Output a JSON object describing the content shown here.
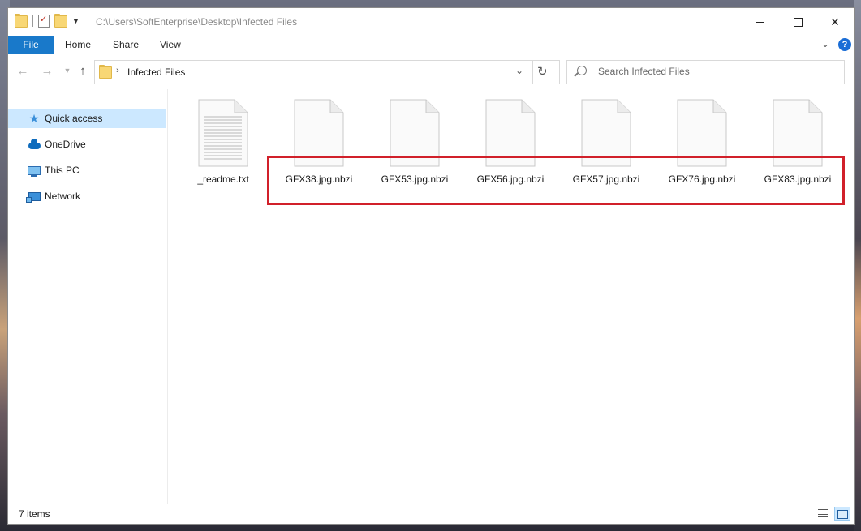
{
  "window": {
    "title_path": "C:\\Users\\SoftEnterprise\\Desktop\\Infected Files",
    "minimize": "minimize",
    "maximize": "maximize",
    "close": "close"
  },
  "ribbon": {
    "tabs": [
      "File",
      "Home",
      "Share",
      "View"
    ],
    "help": "?"
  },
  "address": {
    "crumb": "Infected Files"
  },
  "search": {
    "placeholder": "Search Infected Files"
  },
  "nav_pane": {
    "items": [
      {
        "label": "Quick access",
        "icon": "star-icon",
        "selected": true
      },
      {
        "label": "OneDrive",
        "icon": "cloud-icon",
        "selected": false
      },
      {
        "label": "This PC",
        "icon": "computer-icon",
        "selected": false
      },
      {
        "label": "Network",
        "icon": "network-icon",
        "selected": false
      }
    ]
  },
  "files": [
    {
      "name": "_readme.txt",
      "type": "text"
    },
    {
      "name": "GFX38.jpg.nbzi",
      "type": "blank"
    },
    {
      "name": "GFX53.jpg.nbzi",
      "type": "blank"
    },
    {
      "name": "GFX56.jpg.nbzi",
      "type": "blank"
    },
    {
      "name": "GFX57.jpg.nbzi",
      "type": "blank"
    },
    {
      "name": "GFX76.jpg.nbzi",
      "type": "blank"
    },
    {
      "name": "GFX83.jpg.nbzi",
      "type": "blank"
    }
  ],
  "status": {
    "item_count": "7 items"
  },
  "colors": {
    "accent": "#1979ca",
    "selection": "#cce8ff",
    "highlight_box": "#d1202a"
  }
}
